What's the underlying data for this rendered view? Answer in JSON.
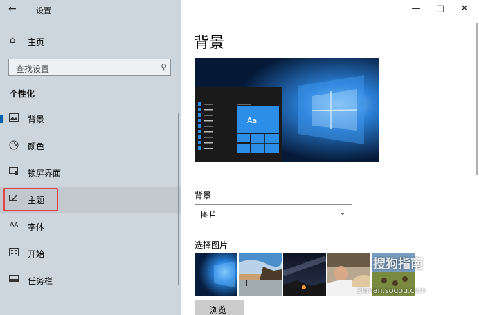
{
  "window": {
    "title": "设置"
  },
  "sidebar": {
    "home_label": "主页",
    "search_placeholder": "查找设置",
    "section_title": "个性化",
    "items": [
      {
        "label": "背景",
        "icon": "picture-icon"
      },
      {
        "label": "颜色",
        "icon": "palette-icon"
      },
      {
        "label": "锁屏界面",
        "icon": "lock-screen-icon"
      },
      {
        "label": "主题",
        "icon": "theme-icon"
      },
      {
        "label": "字体",
        "icon": "font-icon"
      },
      {
        "label": "开始",
        "icon": "start-icon"
      },
      {
        "label": "任务栏",
        "icon": "taskbar-icon"
      }
    ]
  },
  "main": {
    "title": "背景",
    "preview_tile_text": "Aa",
    "background_label": "背景",
    "background_value": "图片",
    "choose_picture_label": "选择图片",
    "browse_label": "浏览"
  },
  "watermark": {
    "brand": "搜狗指南",
    "url": "zhinan.sogou.com"
  },
  "colors": {
    "accent": "#0063b1",
    "highlight_border": "#e04646",
    "sidebar_bg": "#cdd6dc"
  }
}
